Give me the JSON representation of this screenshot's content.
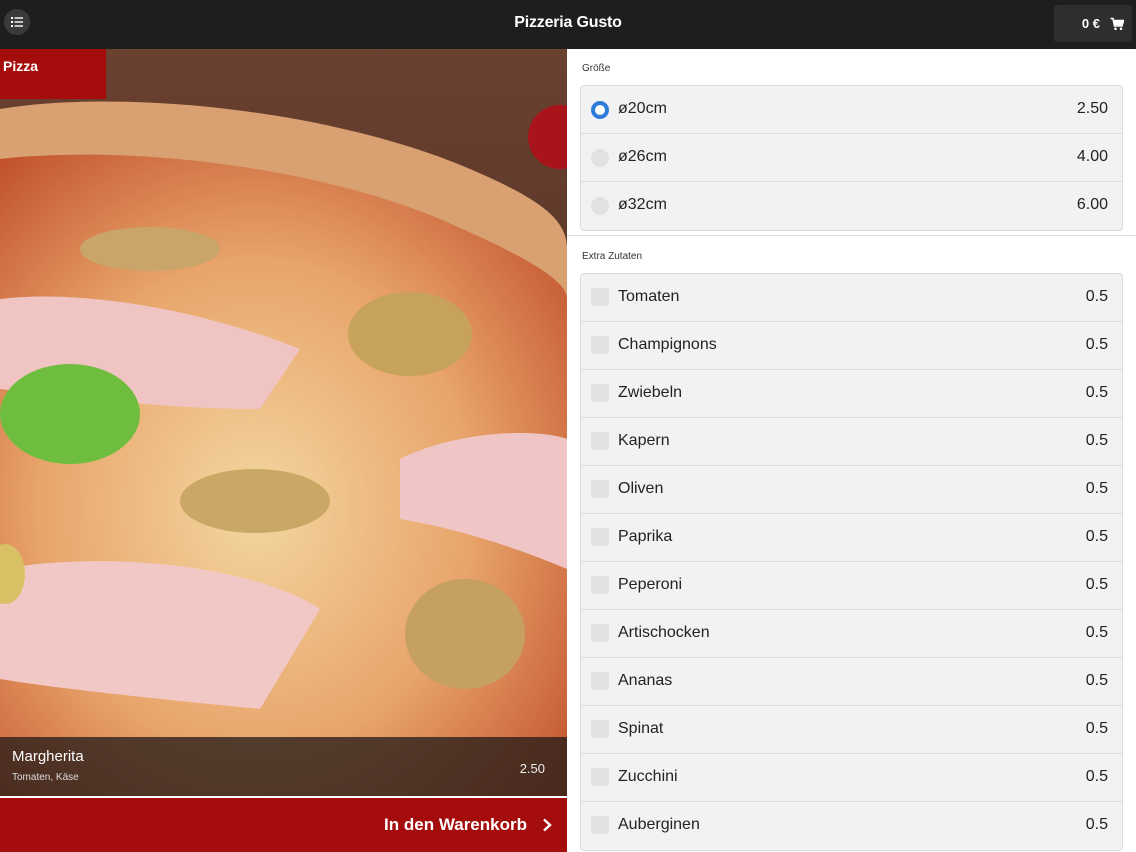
{
  "header": {
    "title": "Pizzeria Gusto",
    "cart_total": "0 €",
    "menu_icon": "list-icon",
    "cart_icon": "cart-icon"
  },
  "product": {
    "category": "Pizza",
    "name": "Margherita",
    "description": "Tomaten, Käse",
    "price": "2.50",
    "add_to_cart": "In den Warenkorb"
  },
  "sizes": {
    "label": "Größe",
    "options": [
      {
        "label": "ø20cm",
        "price": "2.50",
        "selected": true
      },
      {
        "label": "ø26cm",
        "price": "4.00",
        "selected": false
      },
      {
        "label": "ø32cm",
        "price": "6.00",
        "selected": false
      }
    ]
  },
  "extras": {
    "label": "Extra Zutaten",
    "options": [
      {
        "label": "Tomaten",
        "price": "0.5"
      },
      {
        "label": "Champignons",
        "price": "0.5"
      },
      {
        "label": "Zwiebeln",
        "price": "0.5"
      },
      {
        "label": "Kapern",
        "price": "0.5"
      },
      {
        "label": "Oliven",
        "price": "0.5"
      },
      {
        "label": "Paprika",
        "price": "0.5"
      },
      {
        "label": "Peperoni",
        "price": "0.5"
      },
      {
        "label": "Artischocken",
        "price": "0.5"
      },
      {
        "label": "Ananas",
        "price": "0.5"
      },
      {
        "label": "Spinat",
        "price": "0.5"
      },
      {
        "label": "Zucchini",
        "price": "0.5"
      },
      {
        "label": "Auberginen",
        "price": "0.5"
      }
    ]
  },
  "colors": {
    "brand_red": "#a50d0d",
    "topbar": "#1e1e1e",
    "radio_selected": "#2f7bd8"
  }
}
